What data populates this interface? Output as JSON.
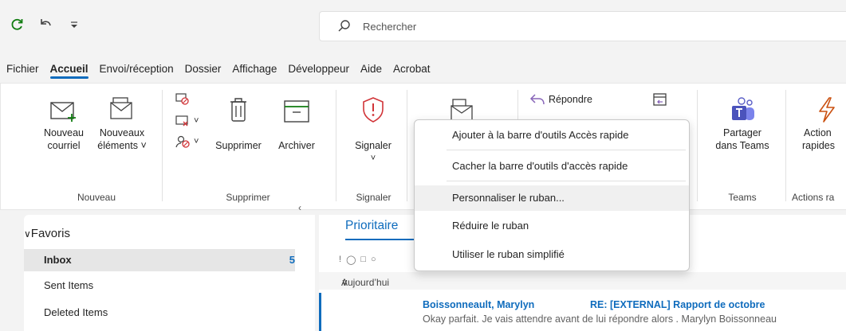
{
  "search": {
    "placeholder": "Rechercher"
  },
  "tabs": [
    "Fichier",
    "Accueil",
    "Envoi/réception",
    "Dossier",
    "Affichage",
    "Développeur",
    "Aide",
    "Acrobat"
  ],
  "ribbon": {
    "nouveau": {
      "new_mail": [
        "Nouveau",
        "courriel"
      ],
      "new_items": [
        "Nouveaux",
        "éléments ˅"
      ],
      "label": "Nouveau"
    },
    "supprimer": {
      "delete": "Supprimer",
      "archive": "Archiver",
      "label": "Supprimer"
    },
    "signaler": {
      "report": "Signaler",
      "label": "Signaler",
      "chevron": "˅"
    },
    "respond": {
      "reply": "Répondre"
    },
    "teams": {
      "share": [
        "Partager",
        "dans Teams"
      ],
      "label": "Teams"
    },
    "actions": {
      "quick": [
        "Action",
        "rapides"
      ],
      "label": "Actions ra"
    }
  },
  "context_menu": {
    "items": [
      "Ajouter à la barre d'outils Accès rapide",
      "Cacher la barre d'outils d'accès rapide",
      "Personnaliser le ruban...",
      "Réduire le ruban",
      "Utiliser le ruban simplifié"
    ],
    "hovered_index": 2
  },
  "nav": {
    "favorites": "Favoris",
    "collapse": "‹",
    "items": [
      {
        "label": "Inbox",
        "count": "5"
      },
      {
        "label": "Sent Items",
        "count": ""
      },
      {
        "label": "Deleted Items",
        "count": ""
      }
    ]
  },
  "mail": {
    "tab": "Prioritaire",
    "group": "Aujourd’hui",
    "rows": [
      {
        "sender": "Boissonneault, Marylyn",
        "subject": "RE: [EXTERNAL] Rapport de octobre",
        "preview": "Okay parfait. Je vais attendre avant de lui répondre alors .  Marylyn Boissonneau"
      }
    ]
  },
  "colors": {
    "accent": "#0f6cbd",
    "bg": "#f3f3f3",
    "teams": "#5b5fc7",
    "report": "#d13438"
  }
}
